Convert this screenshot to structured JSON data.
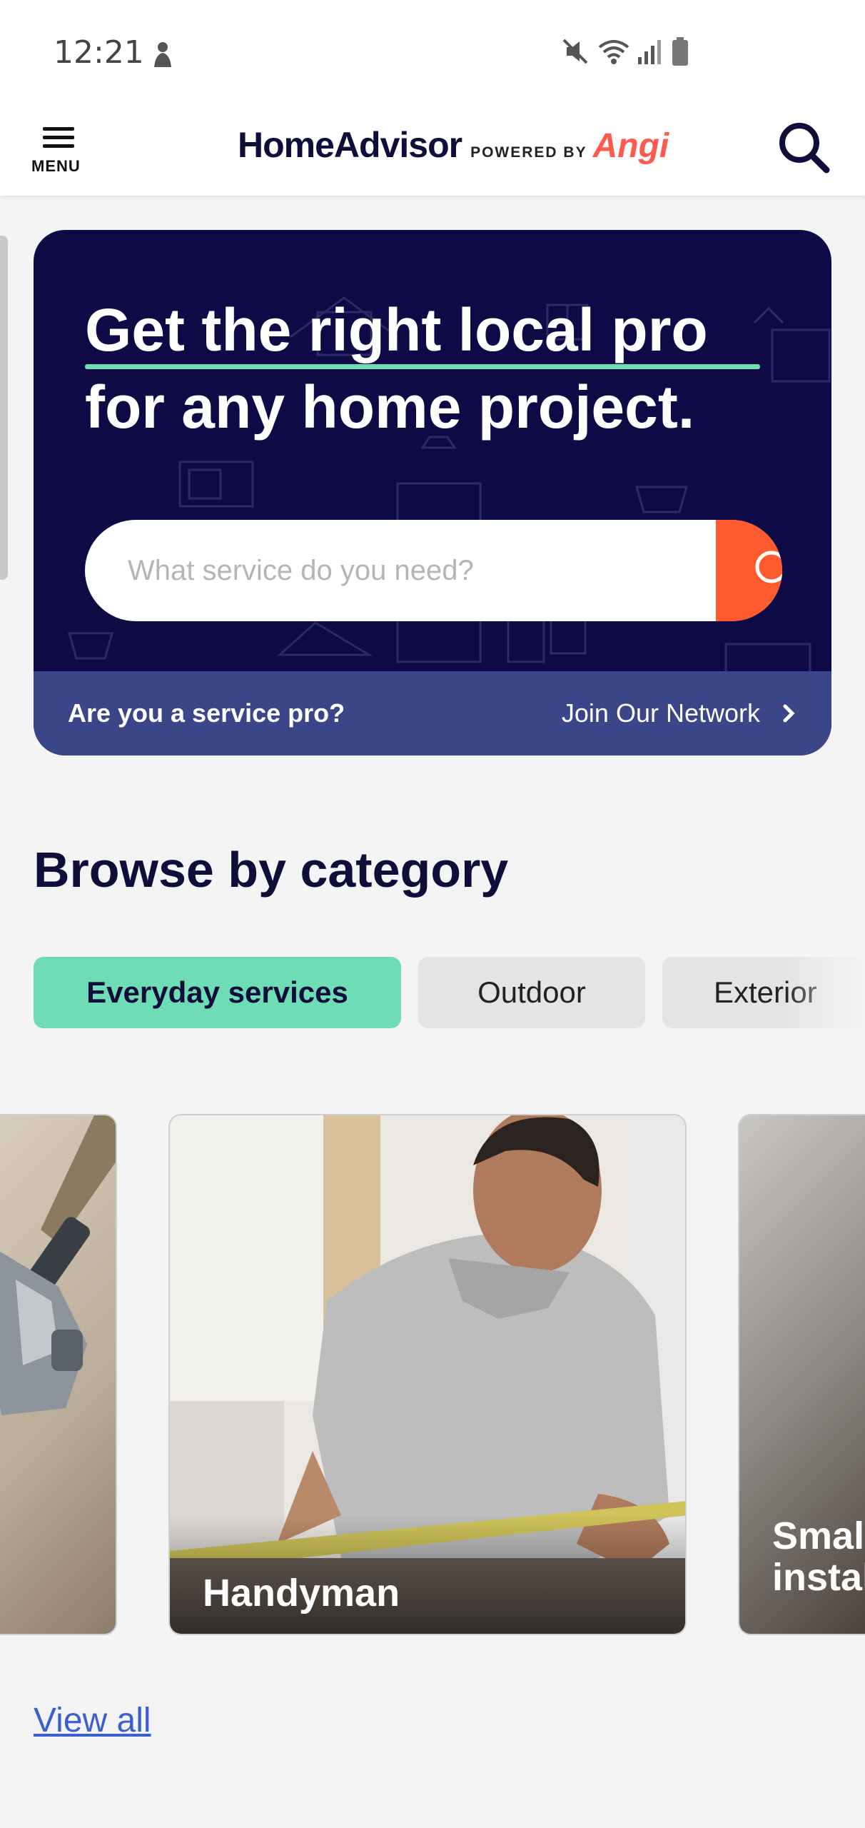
{
  "status_bar": {
    "time": "12:21"
  },
  "header": {
    "menu_label": "MENU",
    "logo_main": "HomeAdvisor",
    "logo_powered": "POWERED BY",
    "logo_brand": "Angi"
  },
  "hero": {
    "headline_line1": "Get the right local pro",
    "headline_line2": "for any home project.",
    "search_placeholder": "What service do you need?",
    "pro_question": "Are you a service pro?",
    "pro_link": "Join Our Network"
  },
  "category": {
    "title": "Browse by category",
    "chips": [
      {
        "label": "Everyday services",
        "active": true
      },
      {
        "label": "Outdoor",
        "active": false
      },
      {
        "label": "Exterior",
        "active": false
      }
    ],
    "cards": [
      {
        "label": ""
      },
      {
        "label": "Handyman"
      },
      {
        "label": "Small\ninstal"
      }
    ],
    "view_all": "View all"
  },
  "colors": {
    "navy": "#0d0a45",
    "accent_orange": "#ff5a2e",
    "mint": "#6edcb5",
    "pro_bar": "#3a4687",
    "link_blue": "#3a5fd0"
  }
}
